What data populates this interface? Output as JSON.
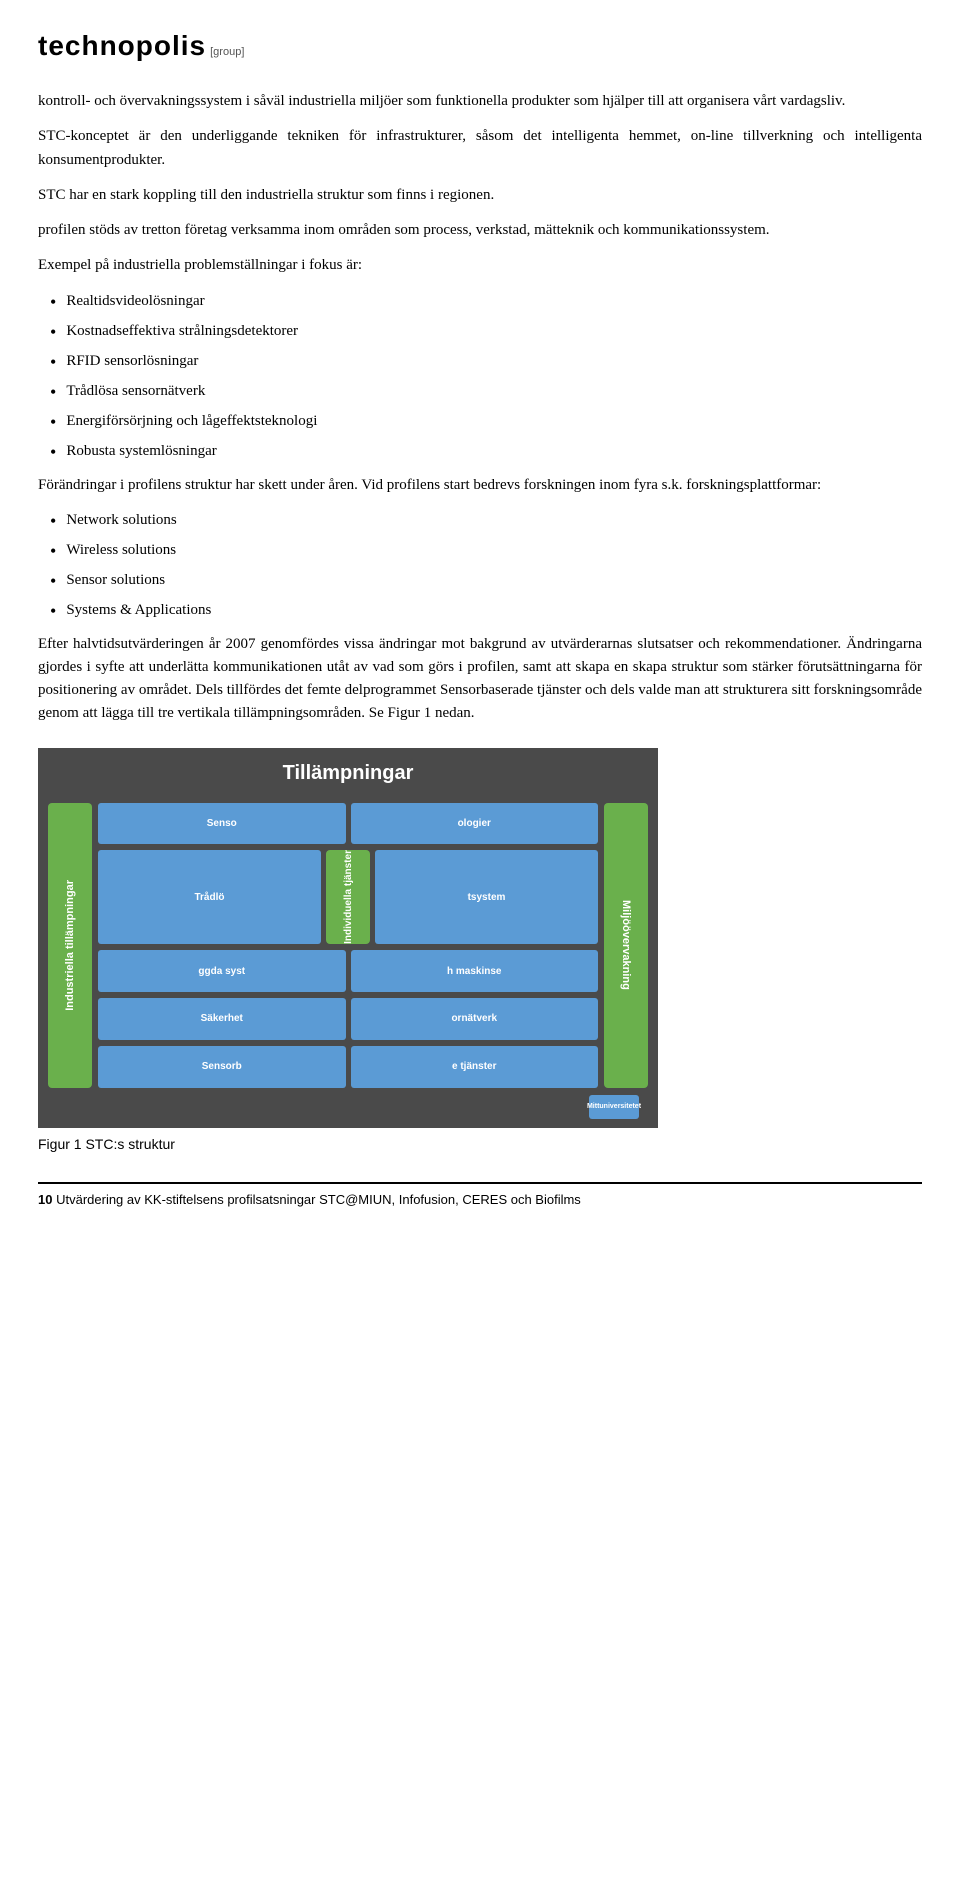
{
  "header": {
    "brand_main": "technopolis",
    "brand_sub": "[group]"
  },
  "paragraphs": {
    "p1": "kontroll- och övervakningssystem i såväl industriella miljöer som funktionella produkter som hjälper till att organisera vårt vardagsliv.",
    "p2": "STC-konceptet är den underliggande tekniken för infrastrukturer, såsom det intelligenta hemmet, on-line tillverkning och intelligenta konsumentprodukter.",
    "p3": "STC har en stark koppling till den industriella struktur som finns i regionen.",
    "p4": "profilen stöds av tretton företag verksamma inom områden som process, verkstad, mätteknik och kommunikationssystem.",
    "p5": "Exempel på industriella problemställningar i fokus är:",
    "bullets1": [
      "Realtidsvideolösningar",
      "Kostnadseffektiva strålningsdetektorer",
      "RFID sensorlösningar",
      "Trådlösa sensornätverk",
      "Energiförsörjning och lågeffektsteknologi",
      "Robusta systemlösningar"
    ],
    "p6": "Förändringar i profilens struktur har skett under åren. Vid profilens start bedrevs forskningen inom fyra s.k. forskningsplattformar:",
    "bullets2": [
      "Network solutions",
      "Wireless solutions",
      "Sensor solutions",
      "Systems & Applications"
    ],
    "p7": "Efter halvtidsutvärderingen år 2007 genomfördes vissa ändringar mot bakgrund av utvärderarnas slutsatser och rekommendationer. Ändringarna gjordes i syfte att underlätta kommunikationen utåt av vad som görs i profilen, samt att skapa en skapa struktur som stärker förutsättningarna för positionering av området. Dels tillfördes det femte delprogrammet Sensorbaserade tjänster och dels valde man att strukturera sitt forskningsområde genom att lägga till tre vertikala tillämpningsområden. Se Figur 1 nedan."
  },
  "figure": {
    "title": "Tillämpningar",
    "left_col_label": "Industriella tillämpningar",
    "right_col_label": "Miljöövervakning",
    "mid_col_label": "Individuella tjänster",
    "rows": [
      {
        "cells": [
          "Senso",
          "ologier"
        ],
        "mid_label": ""
      },
      {
        "cells": [
          "Trådlö",
          "tsystem"
        ],
        "mid_label": ""
      },
      {
        "cells": [
          "ggda syst",
          "h maskinse"
        ],
        "mid_label": ""
      },
      {
        "cells": [
          "Säkerhet",
          "ornätverk"
        ],
        "mid_label": ""
      },
      {
        "cells": [
          "Sensorb",
          "e tjänster"
        ],
        "mid_label": ""
      }
    ],
    "logo_text": "Mittuniversitetet",
    "caption": "Figur 1  STC:s struktur"
  },
  "footer": {
    "page_number": "10",
    "footer_text": "Utvärdering av KK-stiftelsens profilsatsningar STC@MIUN, Infofusion, CERES och Biofilms"
  }
}
